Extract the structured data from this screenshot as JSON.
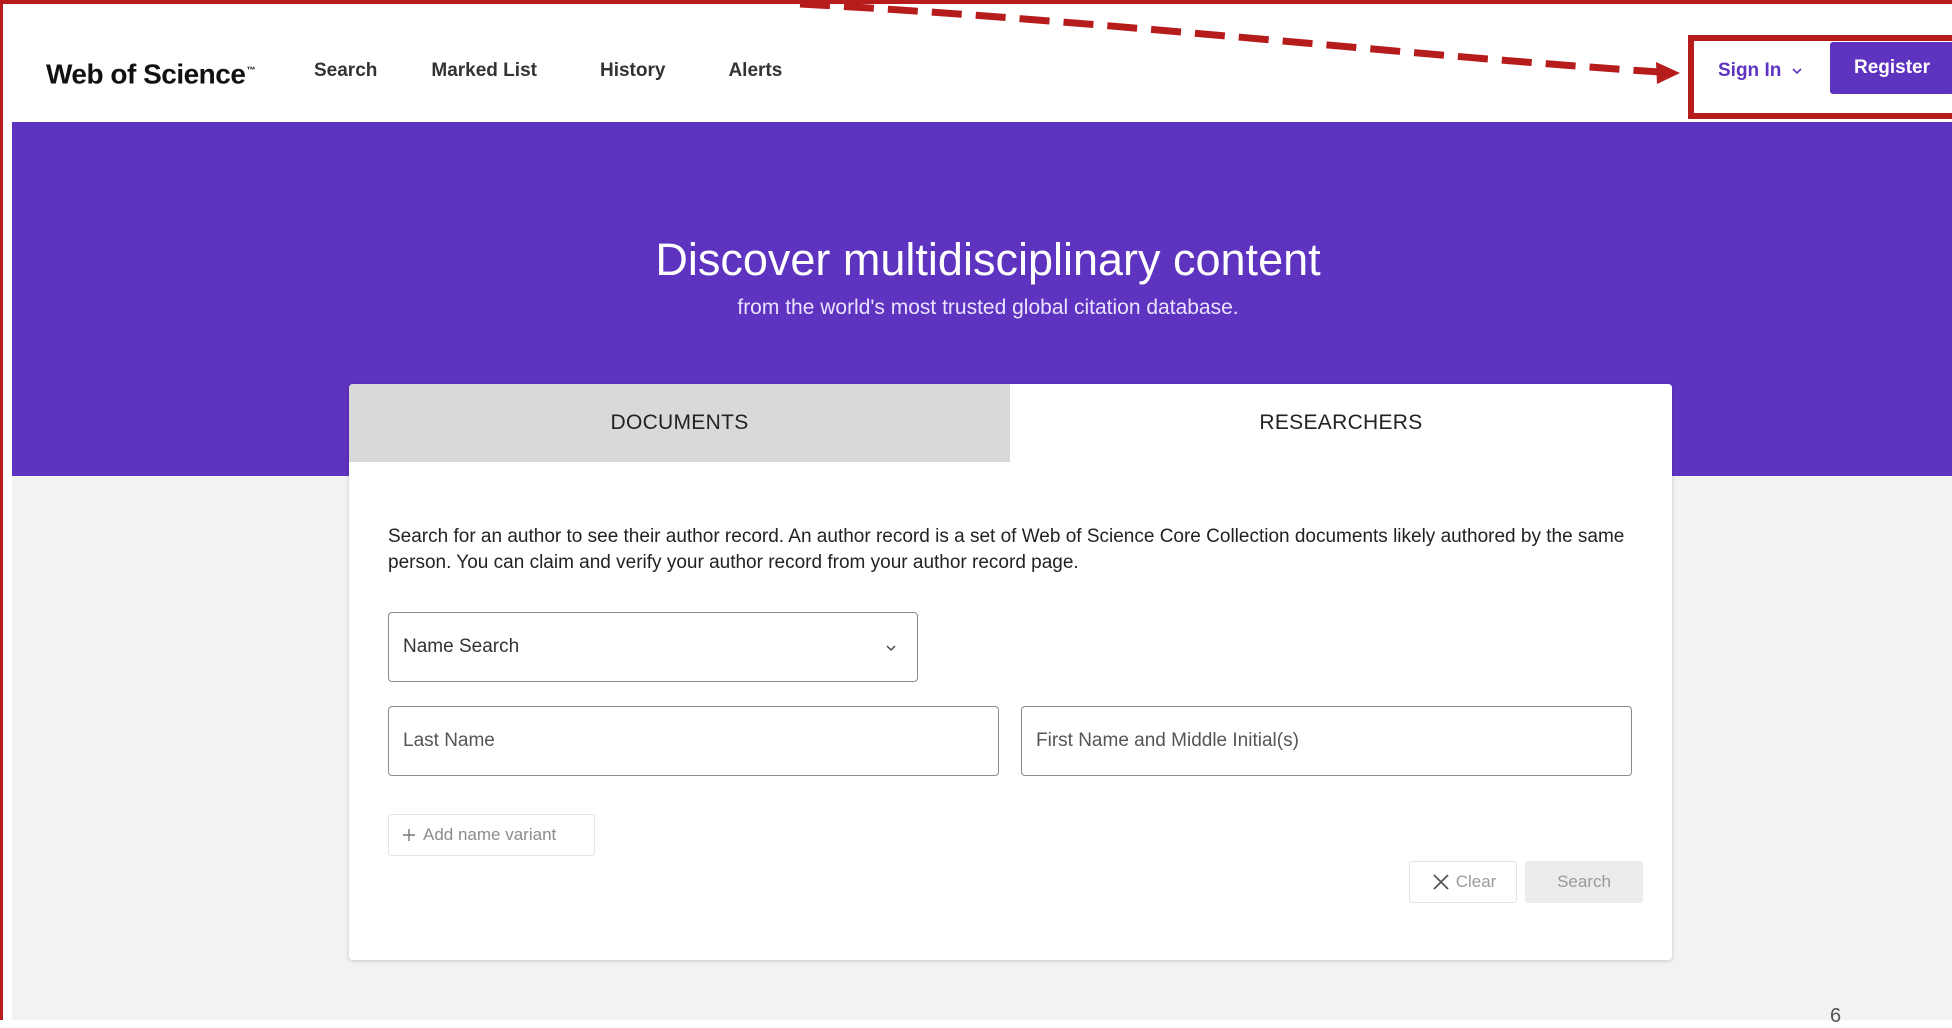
{
  "brand": {
    "name": "Web of Science",
    "tm": "™"
  },
  "nav": [
    {
      "label": "Search"
    },
    {
      "label": "Marked List"
    },
    {
      "label": "History"
    },
    {
      "label": "Alerts"
    }
  ],
  "account": {
    "sign_in_label": "Sign In",
    "register_label": "Register"
  },
  "hero": {
    "title": "Discover multidisciplinary content",
    "subtitle": "from the world's most trusted global citation database."
  },
  "tabs": [
    {
      "label": "DOCUMENTS",
      "active": false
    },
    {
      "label": "RESEARCHERS",
      "active": true
    }
  ],
  "researchers": {
    "description": "Search for an author to see their author record. An author record is a set of Web of Science Core Collection documents likely authored by the same person. You can claim and verify your author record from your author record page.",
    "search_type": "Name Search",
    "last_name_placeholder": "Last Name",
    "first_name_placeholder": "First Name and Middle Initial(s)",
    "add_variant_label": "Add name variant",
    "clear_label": "Clear",
    "search_label": "Search"
  },
  "colors": {
    "brand_purple": "#5e33bf",
    "annotation_red": "#b71c1c"
  },
  "icons": [
    "chevron-down-icon",
    "plus-icon",
    "close-icon",
    "arrow-icon"
  ],
  "page_number": "6"
}
